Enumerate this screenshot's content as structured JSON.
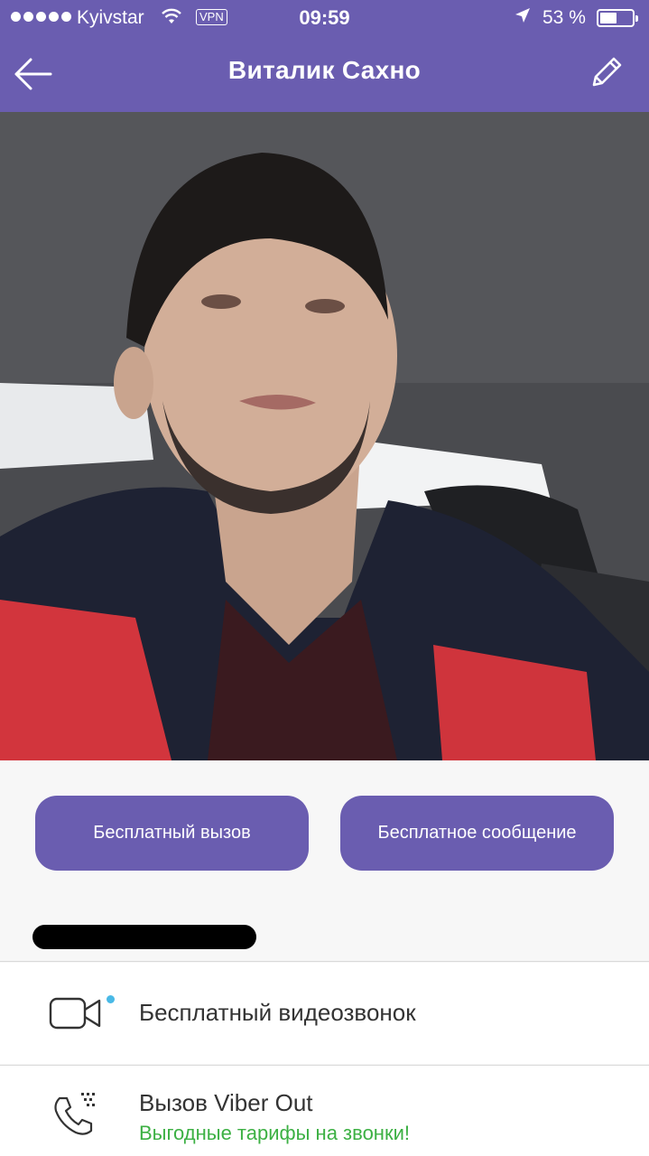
{
  "status_bar": {
    "carrier": "Kyivstar",
    "vpn": "VPN",
    "time": "09:59",
    "battery_text": "53 %",
    "battery_level": 0.53
  },
  "nav": {
    "title": "Виталик Сахно"
  },
  "actions": {
    "call_label": "Бесплатный вызов",
    "message_label": "Бесплатное сообщение"
  },
  "options": {
    "video_label": "Бесплатный видеозвонок",
    "viber_out_label": "Вызов Viber Out",
    "viber_out_sub": "Выгодные тарифы на звонки!"
  },
  "colors": {
    "brand": "#6a5db0",
    "promo_green": "#3cb043",
    "new_dot": "#49b9e6"
  },
  "icons": {
    "back": "arrow-left-icon",
    "edit": "pencil-icon",
    "video": "video-camera-icon",
    "phone": "phone-icon"
  }
}
